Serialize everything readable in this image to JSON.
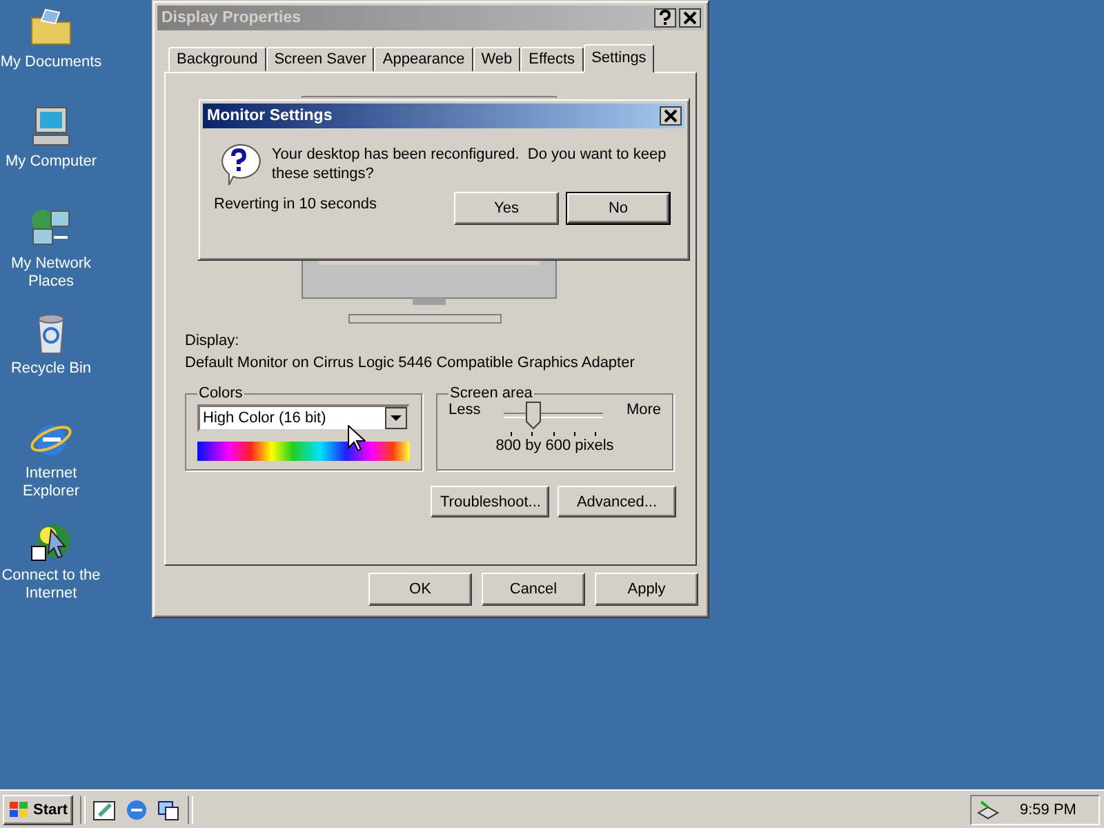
{
  "desktop_icons": [
    {
      "label": "My Documents",
      "kind": "documents"
    },
    {
      "label": "My Computer",
      "kind": "computer"
    },
    {
      "label": "My Network Places",
      "kind": "network"
    },
    {
      "label": "Recycle Bin",
      "kind": "recycle"
    },
    {
      "label": "Internet Explorer",
      "kind": "browser"
    },
    {
      "label": "Connect to the Internet",
      "kind": "connect"
    }
  ],
  "window": {
    "title": "Display Properties",
    "active": false,
    "tabs": [
      {
        "label": "Background",
        "selected": false
      },
      {
        "label": "Screen Saver",
        "selected": false
      },
      {
        "label": "Appearance",
        "selected": false
      },
      {
        "label": "Web",
        "selected": false
      },
      {
        "label": "Effects",
        "selected": false
      },
      {
        "label": "Settings",
        "selected": true
      }
    ],
    "display_label": "Display:",
    "display_value": "Default Monitor on Cirrus Logic 5446 Compatible Graphics Adapter",
    "colors": {
      "legend": "Colors",
      "value": "High Color (16 bit)"
    },
    "screen_area": {
      "legend": "Screen area",
      "less": "Less",
      "more": "More",
      "level": 0.25,
      "reading": "800 by 600 pixels"
    },
    "panel_buttons": [
      "Troubleshoot...",
      "Advanced..."
    ],
    "footer_buttons": [
      "OK",
      "Cancel",
      "Apply"
    ]
  },
  "dialog": {
    "title": "Monitor Settings",
    "active": true,
    "message": "Your desktop has been reconfigured.  Do you want to keep these settings?",
    "countdown": "Reverting in 10 seconds",
    "buttons": [
      {
        "label": "Yes",
        "default": false
      },
      {
        "label": "No",
        "default": true
      }
    ]
  },
  "taskbar": {
    "start": "Start",
    "clock": "9:59 PM"
  }
}
